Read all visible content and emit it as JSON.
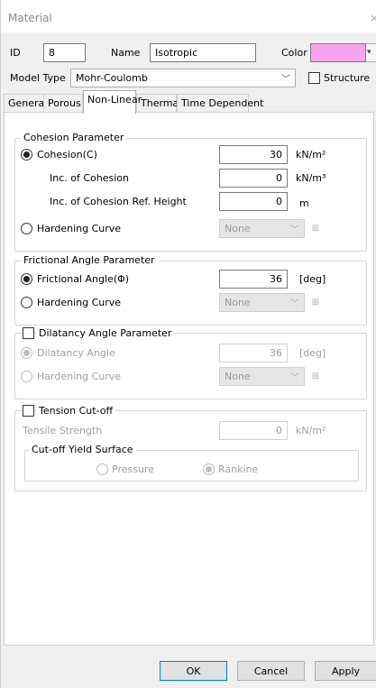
{
  "window": {
    "title": "Material",
    "close_glyph": "×"
  },
  "header": {
    "id_label": "ID",
    "id_value": "8",
    "name_label": "Name",
    "name_value": "Isotropic",
    "color_label": "Color",
    "color_value": "#f7a3ef",
    "model_type_label": "Model Type",
    "model_type_value": "Mohr-Coulomb",
    "structure_label": "Structure",
    "structure_checked": false
  },
  "tabs": [
    {
      "label": "General",
      "active": false
    },
    {
      "label": "Porous",
      "active": false
    },
    {
      "label": "Non-Linear",
      "active": true
    },
    {
      "label": "Thermal",
      "active": false
    },
    {
      "label": "Time Dependent",
      "active": false
    }
  ],
  "cohesion": {
    "group_label": "Cohesion Parameter",
    "cohesion_label": "Cohesion(C)",
    "cohesion_value": "30",
    "cohesion_unit": "kN/m²",
    "inc_label": "Inc. of Cohesion",
    "inc_value": "0",
    "inc_unit": "kN/m³",
    "ref_label": "Inc. of Cohesion Ref. Height",
    "ref_value": "0",
    "ref_unit": "m",
    "hardening_label": "Hardening Curve",
    "hardening_value": "None"
  },
  "friction": {
    "group_label": "Frictional Angle Parameter",
    "angle_label": "Frictional Angle(Φ)",
    "angle_value": "36",
    "angle_unit": "[deg]",
    "hardening_label": "Hardening Curve",
    "hardening_value": "None"
  },
  "dilatancy": {
    "group_label": "Dilatancy Angle Parameter",
    "angle_label": "Dilatancy Angle",
    "angle_value": "36",
    "angle_unit": "[deg]",
    "hardening_label": "Hardening Curve",
    "hardening_value": "None"
  },
  "tension": {
    "group_label": "Tension Cut-off",
    "strength_label": "Tensile Strength",
    "strength_value": "0",
    "strength_unit": "kN/m²",
    "surface_label": "Cut-off Yield Surface",
    "pressure_label": "Pressure",
    "rankine_label": "Rankine"
  },
  "footer": {
    "ok_label": "OK",
    "cancel_label": "Cancel",
    "apply_label": "Apply"
  },
  "icons": {
    "dropdown": "chevron-down-icon",
    "curve": "curve-editor-icon"
  }
}
